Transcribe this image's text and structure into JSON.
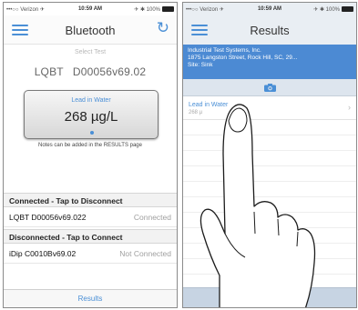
{
  "left": {
    "status": {
      "carrier": "•••○○ Verizon ✈",
      "time": "10:59 AM",
      "battery": "✈ ✱ 100%"
    },
    "nav": {
      "title": "Bluetooth",
      "menu_icon": "hamburger-menu-icon",
      "refresh_icon": "refresh-icon"
    },
    "select_test": "Select Test",
    "device": {
      "model": "LQBT",
      "serial": "D00056v69.02"
    },
    "result_card": {
      "label": "Lead in Water",
      "value": "268 µg/L"
    },
    "notes": "Notes can be added in the RESULTS page",
    "sections": {
      "connected": {
        "header": "Connected - Tap to Disconnect",
        "rows": [
          {
            "name": "LQBT D00056v69.022",
            "state": "Connected"
          }
        ]
      },
      "disconnected": {
        "header": "Disconnected - Tap to Connect",
        "rows": [
          {
            "name": "iDip  C0010Bv69.02",
            "state": "Not Connected"
          }
        ]
      }
    },
    "footer": "Results"
  },
  "right": {
    "status": {
      "carrier": "•••○○ Verizon ✈",
      "time": "10:59 AM",
      "battery": "✈ ✱ 100%"
    },
    "nav": {
      "title": "Results",
      "menu_icon": "hamburger-menu-icon"
    },
    "site": {
      "company": "Industrial Test Systems, Inc.",
      "address": "1875 Langston Street, Rock Hill, SC, 29...",
      "site": "Site: Sink"
    },
    "camera_icon": "camera-icon",
    "result_item": {
      "name": "Lead in Water",
      "value": "268 µ"
    },
    "colors": {
      "accent": "#4a8fd6",
      "site_panel": "#4c8ad3"
    }
  }
}
